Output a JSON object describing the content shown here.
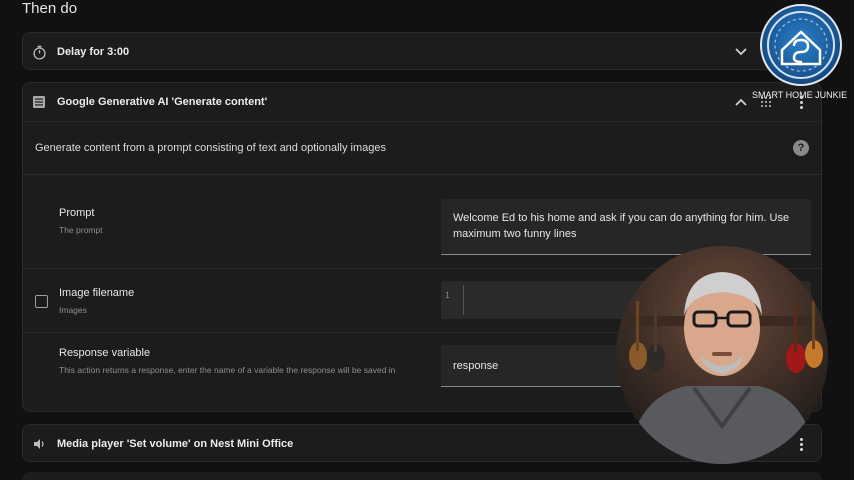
{
  "section": {
    "title": "Then do"
  },
  "delay_card": {
    "title": "Delay for 3:00"
  },
  "ai_card": {
    "title": "Google Generative AI 'Generate content'",
    "description": "Generate content from a prompt consisting of text and optionally images",
    "prompt": {
      "label": "Prompt",
      "sublabel": "The prompt",
      "value": "Welcome Ed to his home and ask if you can do anything for him. Use maximum two funny lines"
    },
    "image_filename": {
      "label": "Image filename",
      "sublabel": "Images",
      "line_number": "1"
    },
    "response_variable": {
      "label": "Response variable",
      "sublabel": "This action returns a response, enter the name of a variable the response will be saved in",
      "value": "response"
    }
  },
  "media_card": {
    "title": "Media player 'Set volume' on Nest Mini Office"
  },
  "overlay": {
    "brand": "SMART HOME JUNKIE"
  },
  "icons": {
    "delay": "timer-icon",
    "ai": "document-list-icon",
    "media": "speaker-icon",
    "help": "help-circle-icon"
  }
}
